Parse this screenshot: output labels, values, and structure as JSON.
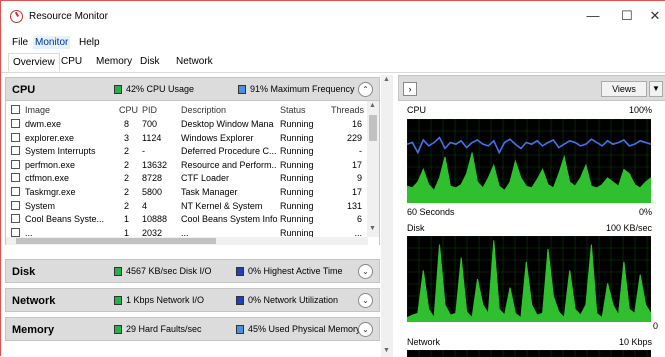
{
  "window": {
    "title": "Resource Monitor",
    "minimize": "—",
    "maximize": "☐",
    "close": "✕"
  },
  "menu": [
    "File",
    "Monitor",
    "Help"
  ],
  "tabs": [
    "Overview",
    "CPU",
    "Memory",
    "Disk",
    "Network"
  ],
  "cpu": {
    "title": "CPU",
    "stat1": "42% CPU Usage",
    "stat1_color": "#22b14c",
    "stat2": "91% Maximum Frequency",
    "stat2_color": "#4a90e2",
    "columns": [
      "Image",
      "CPU",
      "PID",
      "Description",
      "Status",
      "Threads"
    ],
    "rows": [
      [
        "dwm.exe",
        "8",
        "700",
        "Desktop Window Mana",
        "Running",
        "16"
      ],
      [
        "explorer.exe",
        "3",
        "1124",
        "Windows Explorer",
        "Running",
        "229"
      ],
      [
        "System Interrupts",
        "2",
        "-",
        "Deferred Procedure C...",
        "Running",
        "-"
      ],
      [
        "perfmon.exe",
        "2",
        "13632",
        "Resource and Perform...",
        "Running",
        "17"
      ],
      [
        "ctfmon.exe",
        "2",
        "8728",
        "CTF Loader",
        "Running",
        "9"
      ],
      [
        "Taskmgr.exe",
        "2",
        "5800",
        "Task Manager",
        "Running",
        "17"
      ],
      [
        "System",
        "2",
        "4",
        "NT Kernel & System",
        "Running",
        "131"
      ],
      [
        "Cool Beans Syste...",
        "1",
        "10888",
        "Cool Beans System Info",
        "Running",
        "6"
      ],
      [
        "...",
        "1",
        "2032",
        "...",
        "Running",
        "..."
      ]
    ]
  },
  "disk": {
    "title": "Disk",
    "stat1": "4567 KB/sec Disk I/O",
    "stat1_color": "#22b14c",
    "stat2": "0% Highest Active Time",
    "stat2_color": "#1f3fbf"
  },
  "network": {
    "title": "Network",
    "stat1": "1 Kbps Network I/O",
    "stat1_color": "#22b14c",
    "stat2": "0% Network Utilization",
    "stat2_color": "#1f3fbf"
  },
  "memory": {
    "title": "Memory",
    "stat1": "29 Hard Faults/sec",
    "stat1_color": "#22b14c",
    "stat2": "45% Used Physical Memory",
    "stat2_color": "#4a90e2"
  },
  "right": {
    "views_label": "Views",
    "cpu_graph": {
      "label": "CPU",
      "max": "100%",
      "time": "60 Seconds",
      "min": "0%"
    },
    "disk_graph": {
      "label": "Disk",
      "max": "100 KB/sec",
      "min": "0"
    },
    "network_graph": {
      "label": "Network",
      "max": "10 Kbps"
    }
  },
  "graph_series": {
    "cpu_usage": [
      20,
      18,
      25,
      40,
      22,
      15,
      30,
      55,
      20,
      18,
      22,
      35,
      60,
      25,
      18,
      30,
      45,
      20,
      15,
      25,
      50,
      30,
      20,
      18,
      28,
      40,
      22,
      18,
      35,
      55,
      25,
      20,
      30,
      45,
      20,
      18,
      22,
      30,
      25,
      20,
      40,
      35,
      22,
      18,
      25,
      30
    ],
    "cpu_freq": [
      70,
      72,
      60,
      75,
      68,
      72,
      78,
      65,
      72,
      70,
      74,
      66,
      72,
      75,
      70,
      68,
      74,
      60,
      72,
      76,
      70,
      65,
      72,
      70,
      74,
      68,
      72,
      75,
      66,
      70,
      74,
      72,
      68,
      70,
      76,
      72,
      68,
      74,
      70,
      72,
      75,
      68,
      70,
      74,
      72,
      70
    ],
    "disk_io": [
      5,
      8,
      10,
      60,
      15,
      5,
      90,
      20,
      8,
      10,
      75,
      12,
      5,
      50,
      20,
      10,
      95,
      15,
      8,
      40,
      10,
      5,
      70,
      20,
      8,
      10,
      85,
      30,
      12,
      5,
      60,
      15,
      8,
      20,
      90,
      10,
      5,
      45,
      20,
      8,
      70,
      15,
      10,
      55,
      20,
      10
    ]
  }
}
